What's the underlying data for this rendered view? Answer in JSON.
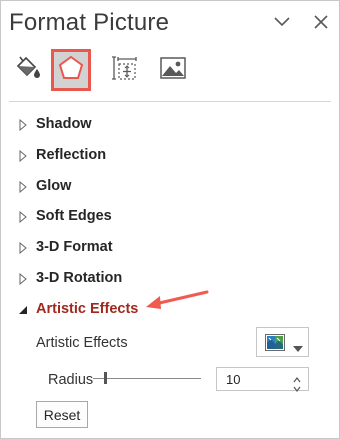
{
  "panel": {
    "title": "Format Picture",
    "controls": {
      "dropdown_icon": "chevron-down-icon",
      "close_icon": "close-icon"
    }
  },
  "tabs": [
    {
      "name": "fill-line",
      "icon": "paint-bucket-icon",
      "active": false
    },
    {
      "name": "effects",
      "icon": "pentagon-icon",
      "active": true
    },
    {
      "name": "size-properties",
      "icon": "size-properties-icon",
      "active": false
    },
    {
      "name": "picture",
      "icon": "picture-icon",
      "active": false
    }
  ],
  "sections": [
    {
      "label": "Shadow",
      "expanded": false
    },
    {
      "label": "Reflection",
      "expanded": false
    },
    {
      "label": "Glow",
      "expanded": false
    },
    {
      "label": "Soft Edges",
      "expanded": false
    },
    {
      "label": "3-D Format",
      "expanded": false
    },
    {
      "label": "3-D Rotation",
      "expanded": false
    },
    {
      "label": "Artistic Effects",
      "expanded": true
    }
  ],
  "artistic_effects": {
    "picker_label": "Artistic Effects",
    "picker_icon": "artistic-effect-thumbnail-icon",
    "radius_label": "Radius",
    "radius_value": "10",
    "reset_label": "Reset"
  },
  "colors": {
    "active_tab_border": "#e8584f",
    "expanded_section_text": "#a0291f",
    "annotation_arrow": "#f05a4f",
    "icon_gray": "#595959"
  }
}
